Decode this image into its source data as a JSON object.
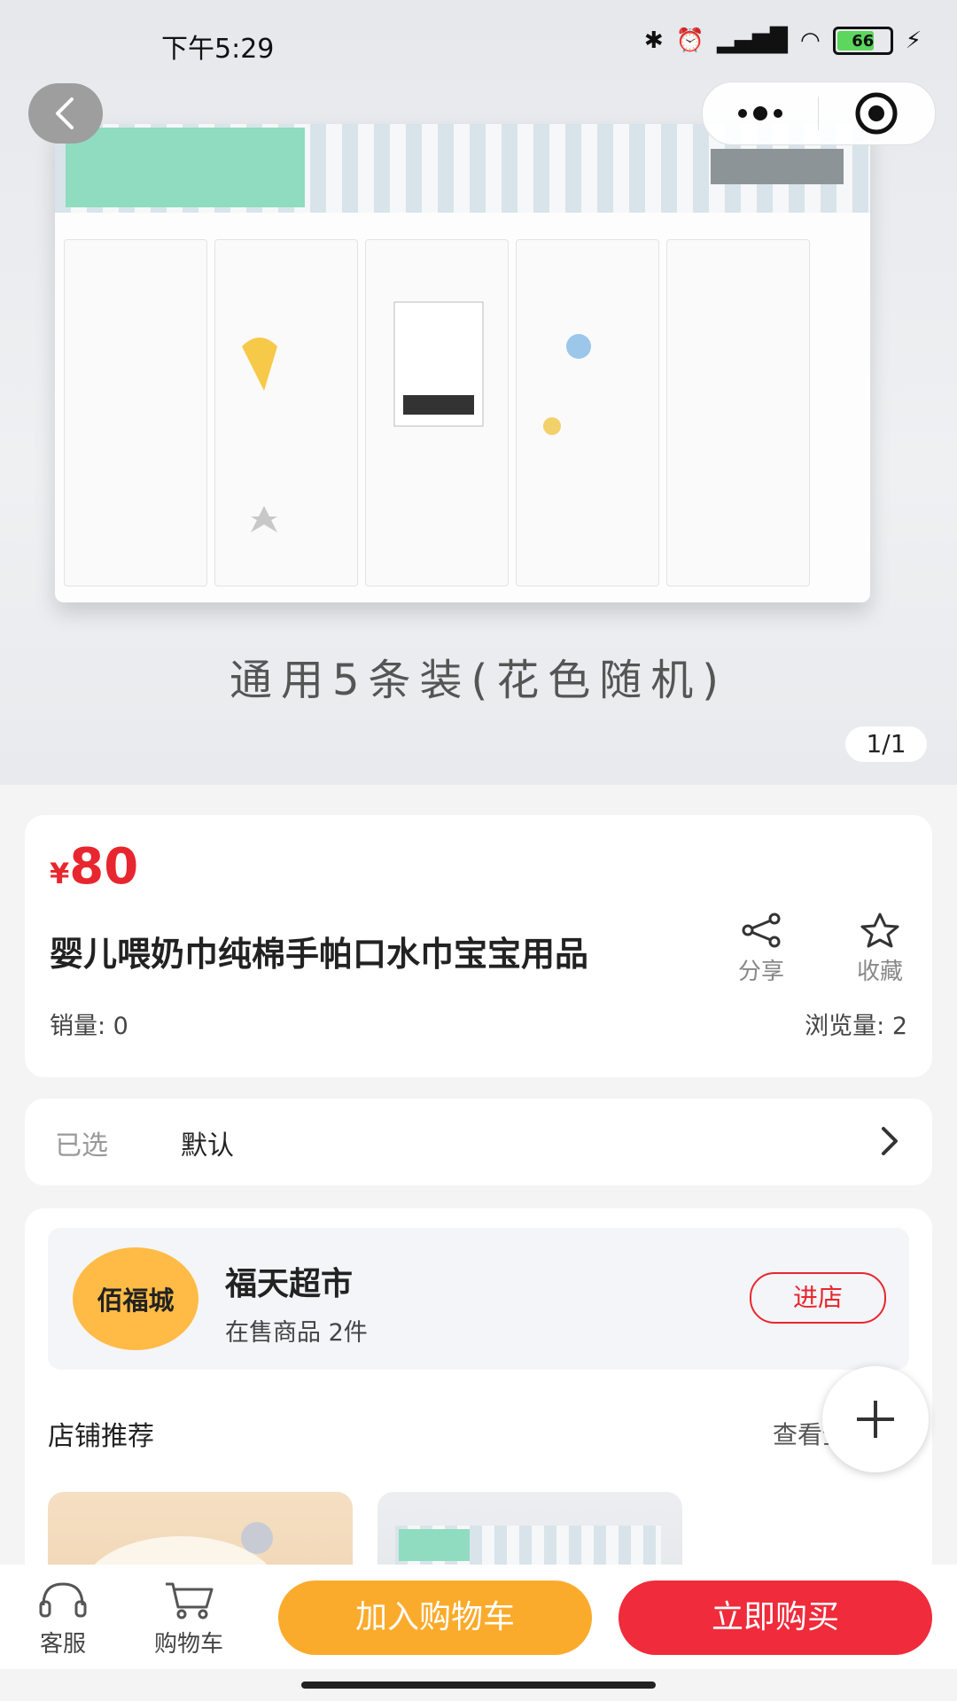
{
  "status_bar": {
    "time": "下午5:29",
    "battery": "66"
  },
  "hero": {
    "caption": "通用5条装(花色随机)",
    "page_indicator": "1/1"
  },
  "product": {
    "price_symbol": "¥",
    "price": "80",
    "title": "婴儿喂奶巾纯棉手帕口水巾宝宝用品",
    "share_label": "分享",
    "favorite_label": "收藏",
    "sales": "销量: 0",
    "views": "浏览量: 2"
  },
  "spec": {
    "label": "已选",
    "value": "默认"
  },
  "shop": {
    "logo_text": "佰福城",
    "name": "福天超市",
    "count": "在售商品 2件",
    "enter_label": "进店",
    "recommend_title": "店铺推荐",
    "view_all": "查看全"
  },
  "bottom_bar": {
    "service_label": "客服",
    "cart_label": "购物车",
    "add_cart_label": "加入购物车",
    "buy_label": "立即购买"
  },
  "colors": {
    "accent": "#e8262f",
    "add_cart": "#fbab2c",
    "buy": "#f02b3b",
    "shop_logo": "#ffbb46"
  }
}
